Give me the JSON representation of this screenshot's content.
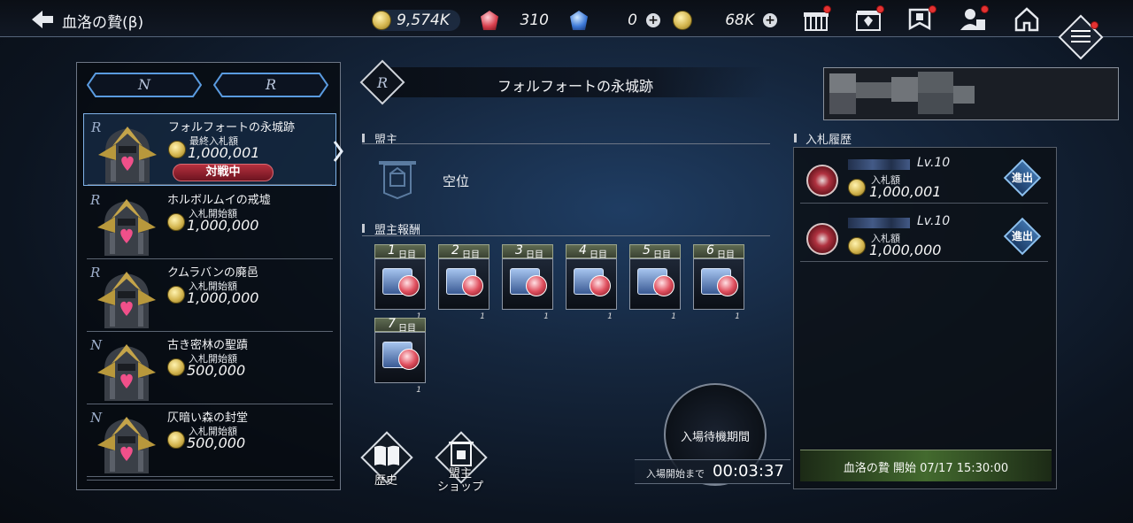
{
  "header": {
    "title": "血洛の贄(β)",
    "resources": {
      "bid_coins": "9,574K",
      "red_gems": "310",
      "blue_gems": "0",
      "gold_coins": "68K"
    },
    "icons": [
      "gift-icon",
      "shop-icon",
      "guild-flag-icon",
      "profile-icon",
      "home-icon",
      "menu-icon"
    ]
  },
  "rank_tabs": [
    "N",
    "R"
  ],
  "fortresses": [
    {
      "rank": "R",
      "name": "フォルフォートの永城跡",
      "label": "最終入札額",
      "value": "1,000,001",
      "status": "対戦中",
      "selected": true
    },
    {
      "rank": "R",
      "name": "ホルボルムイの戒墟",
      "label": "入札開始額",
      "value": "1,000,000",
      "status": ""
    },
    {
      "rank": "R",
      "name": "クムラバンの廃邑",
      "label": "入札開始額",
      "value": "1,000,000",
      "status": ""
    },
    {
      "rank": "N",
      "name": "古き密林の聖蹟",
      "label": "入札開始額",
      "value": "500,000",
      "status": ""
    },
    {
      "rank": "N",
      "name": "仄暗い森の封堂",
      "label": "入札開始額",
      "value": "500,000",
      "status": ""
    }
  ],
  "detail": {
    "rank": "R",
    "title": "フォルフォートの永城跡",
    "lord_section": "盟主",
    "lord_name": "空位",
    "reward_section": "盟主報酬",
    "day_unit": "日目",
    "rewards": [
      {
        "day": "1",
        "qty": "1"
      },
      {
        "day": "2",
        "qty": "1"
      },
      {
        "day": "3",
        "qty": "1"
      },
      {
        "day": "4",
        "qty": "1"
      },
      {
        "day": "5",
        "qty": "1"
      },
      {
        "day": "6",
        "qty": "1"
      },
      {
        "day": "7",
        "qty": "1"
      }
    ],
    "history_button": "歴史",
    "shop_button": "盟主\nショップ"
  },
  "entry": {
    "wait_label": "入場待機期間",
    "timer_label": "入場開始まで",
    "timer_value": "00:03:37"
  },
  "bid_history": {
    "title": "入札履歴",
    "rows": [
      {
        "level": "Lv.10",
        "label": "入札額",
        "value": "1,000,001",
        "button": "進出"
      },
      {
        "level": "Lv.10",
        "label": "入札額",
        "value": "1,000,000",
        "button": "進出"
      }
    ],
    "start_text": "血洛の贄 開始 07/17 15:30:00"
  },
  "colors": {
    "accent": "#7fb2e8",
    "status_red": "#b6303e",
    "start_green": "#436a2e"
  }
}
